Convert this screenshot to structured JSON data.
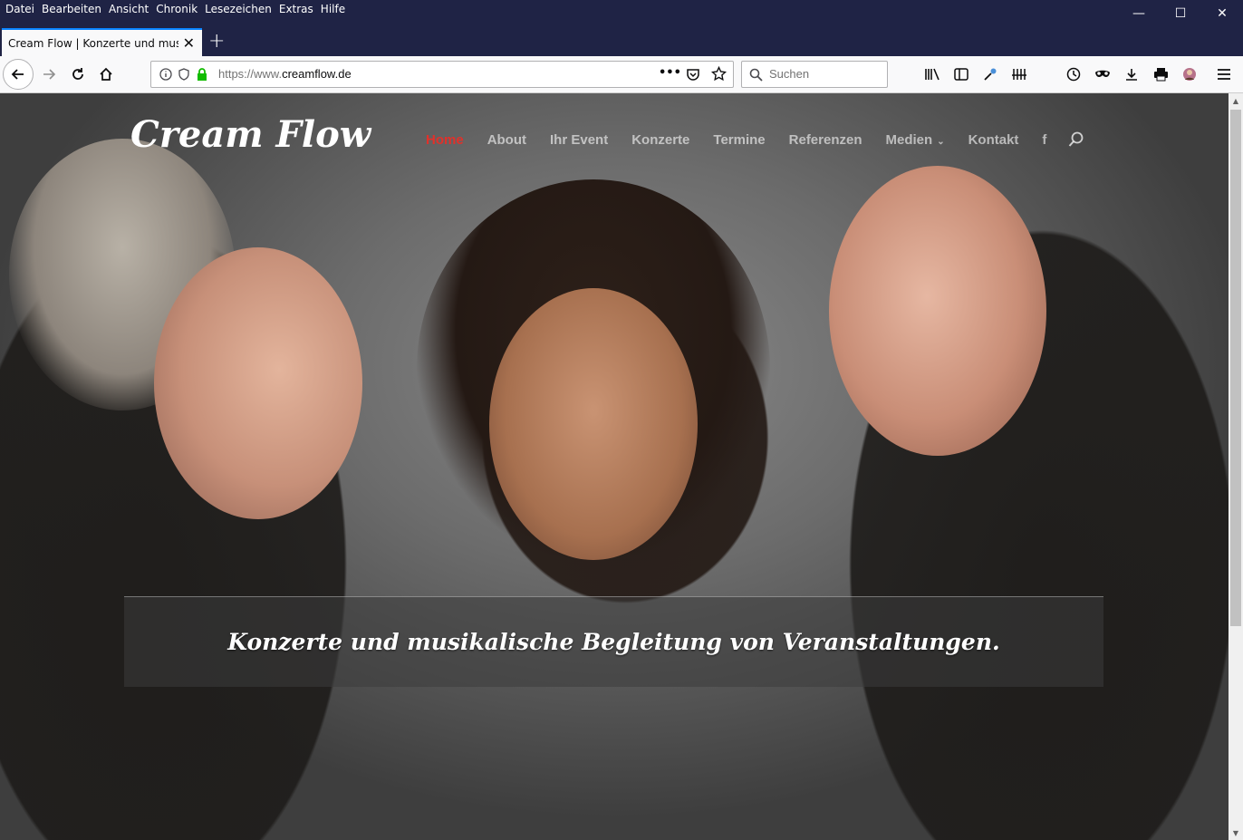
{
  "menu": [
    "Datei",
    "Bearbeiten",
    "Ansicht",
    "Chronik",
    "Lesezeichen",
    "Extras",
    "Hilfe"
  ],
  "window_controls": {
    "minimize": "—",
    "maximize": "☐",
    "close": "✕"
  },
  "tab": {
    "title": "Cream Flow | Konzerte und musikal",
    "close": "✕"
  },
  "new_tab": "+",
  "urlbar": {
    "protocol": "https://www.",
    "host": "creamflow.de",
    "more": "•••"
  },
  "search": {
    "placeholder": "Suchen"
  },
  "site": {
    "logo": "Cream Flow",
    "nav": [
      "Home",
      "About",
      "Ihr Event",
      "Konzerte",
      "Termine",
      "Referenzen",
      "Medien",
      "Kontakt"
    ],
    "active_nav": "Home",
    "facebook": "f",
    "hero_text": "Konzerte und musikalische Begleitung von Veranstaltungen."
  },
  "colors": {
    "active_nav": "#e0312b",
    "tab_accent": "#0a84ff",
    "secure_lock": "#12bc00"
  }
}
